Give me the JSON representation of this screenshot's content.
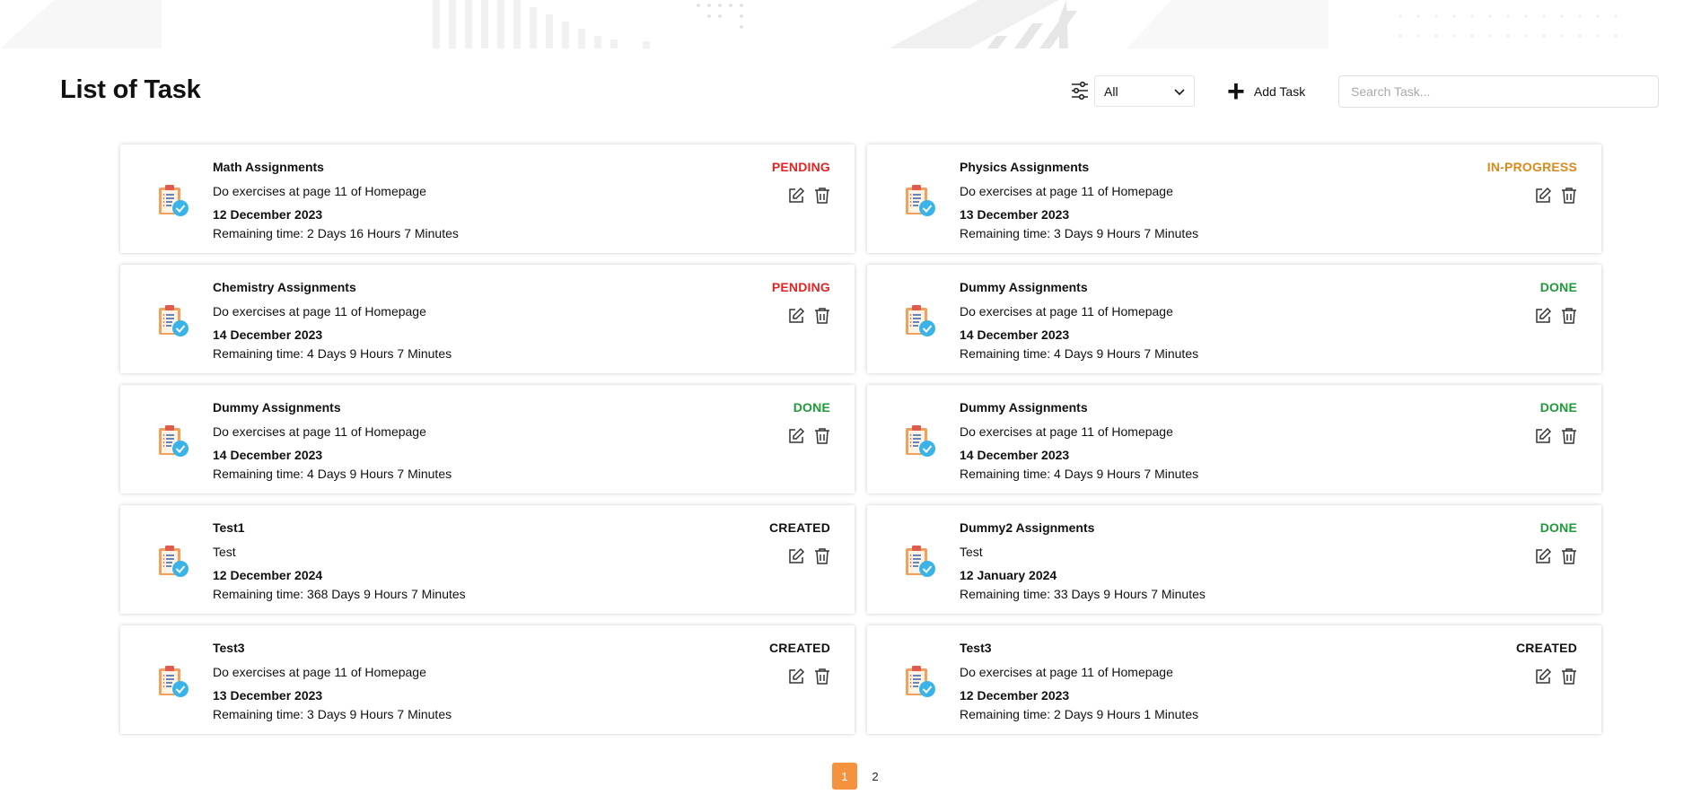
{
  "header": {
    "title": "List of Task",
    "filter_value": "All",
    "add_task_label": "Add Task",
    "search_placeholder": "Search Task..."
  },
  "colors": {
    "pending": "#e02424",
    "in_progress": "#d98a1a",
    "done": "#1f9a3a",
    "created": "#111111",
    "accent": "#f5923e"
  },
  "tasks": [
    {
      "title": "Math Assignments",
      "description": "Do exercises at page 11 of Homepage",
      "date": "12 December 2023",
      "remaining": "Remaining time: 2 Days 16 Hours 7 Minutes",
      "status": "PENDING",
      "status_color": "#e02424"
    },
    {
      "title": "Physics Assignments",
      "description": "Do exercises at page 11 of Homepage",
      "date": "13 December 2023",
      "remaining": "Remaining time: 3 Days 9 Hours 7 Minutes",
      "status": "IN-PROGRESS",
      "status_color": "#d98a1a"
    },
    {
      "title": "Chemistry Assignments",
      "description": "Do exercises at page 11 of Homepage",
      "date": "14 December 2023",
      "remaining": "Remaining time: 4 Days 9 Hours 7 Minutes",
      "status": "PENDING",
      "status_color": "#e02424"
    },
    {
      "title": "Dummy Assignments",
      "description": "Do exercises at page 11 of Homepage",
      "date": "14 December 2023",
      "remaining": "Remaining time: 4 Days 9 Hours 7 Minutes",
      "status": "DONE",
      "status_color": "#1f9a3a"
    },
    {
      "title": "Dummy Assignments",
      "description": "Do exercises at page 11 of Homepage",
      "date": "14 December 2023",
      "remaining": "Remaining time: 4 Days 9 Hours 7 Minutes",
      "status": "DONE",
      "status_color": "#1f9a3a"
    },
    {
      "title": "Dummy Assignments",
      "description": "Do exercises at page 11 of Homepage",
      "date": "14 December 2023",
      "remaining": "Remaining time: 4 Days 9 Hours 7 Minutes",
      "status": "DONE",
      "status_color": "#1f9a3a"
    },
    {
      "title": "Test1",
      "description": "Test",
      "date": "12 December 2024",
      "remaining": "Remaining time: 368 Days 9 Hours 7 Minutes",
      "status": "CREATED",
      "status_color": "#111111"
    },
    {
      "title": "Dummy2 Assignments",
      "description": "Test",
      "date": "12 January 2024",
      "remaining": "Remaining time: 33 Days 9 Hours 7 Minutes",
      "status": "DONE",
      "status_color": "#1f9a3a"
    },
    {
      "title": "Test3",
      "description": "Do exercises at page 11 of Homepage",
      "date": "13 December 2023",
      "remaining": "Remaining time: 3 Days 9 Hours 7 Minutes",
      "status": "CREATED",
      "status_color": "#111111"
    },
    {
      "title": "Test3",
      "description": "Do exercises at page 11 of Homepage",
      "date": "12 December 2023",
      "remaining": "Remaining time: 2 Days 9 Hours 1 Minutes",
      "status": "CREATED",
      "status_color": "#111111"
    }
  ],
  "pagination": {
    "pages": [
      "1",
      "2"
    ],
    "current": "1"
  }
}
